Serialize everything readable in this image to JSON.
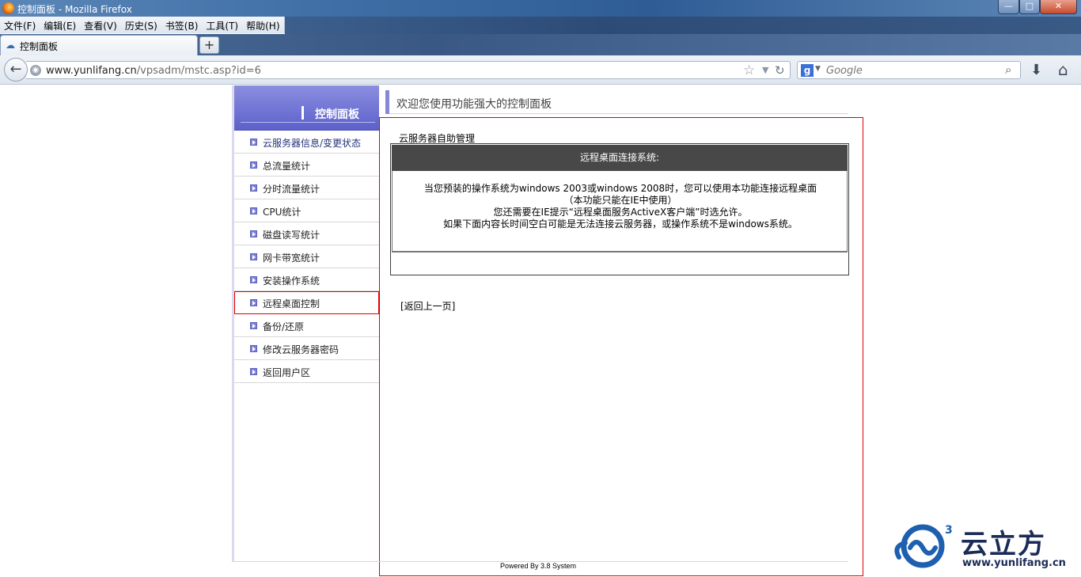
{
  "window": {
    "title": "控制面板 - Mozilla Firefox",
    "controls": {
      "minimize": "—",
      "maximize": "□",
      "close": "✕"
    }
  },
  "menu": [
    "文件(F)",
    "编辑(E)",
    "查看(V)",
    "历史(S)",
    "书签(B)",
    "工具(T)",
    "帮助(H)"
  ],
  "tab": {
    "label": "控制面板",
    "new_tab": "+"
  },
  "navbar": {
    "url_domain": "www.yunlifang.cn",
    "url_path": "/vpsadm/mstc.asp?id=6",
    "search_placeholder": "Google",
    "search_engine": "g"
  },
  "sidebar": {
    "title": "控制面板",
    "items": [
      {
        "label": "云服务器信息/变更状态"
      },
      {
        "label": "总流量统计"
      },
      {
        "label": "分时流量统计"
      },
      {
        "label": "CPU统计"
      },
      {
        "label": "磁盘读写统计"
      },
      {
        "label": "网卡带宽统计"
      },
      {
        "label": "安装操作系统"
      },
      {
        "label": "远程桌面控制"
      },
      {
        "label": "备份/还原"
      },
      {
        "label": "修改云服务器密码"
      },
      {
        "label": "返回用户区"
      }
    ],
    "selected_index": 7
  },
  "header": {
    "welcome": "欢迎您使用功能强大的控制面板"
  },
  "main": {
    "section_title": "云服务器自助管理",
    "panel_title": "远程桌面连接系统:",
    "lines": [
      "当您预装的操作系统为windows 2003或windows 2008时，您可以使用本功能连接远程桌面",
      "（本功能只能在IE中使用）",
      "您还需要在IE提示“远程桌面服务ActiveX客户端”时选允许。",
      "如果下面内容长时间空白可能是无法连接云服务器，或操作系统不是windows系统。"
    ],
    "back_link": "[返回上一页]"
  },
  "footer": {
    "text": "Powered By 3.8 System"
  },
  "logo": {
    "name": "云立方",
    "url": "www.yunlifang.cn",
    "superscript": "3"
  },
  "colors": {
    "accent": "#6366cf",
    "panel_header": "#484848",
    "selection_border": "#e00000"
  }
}
